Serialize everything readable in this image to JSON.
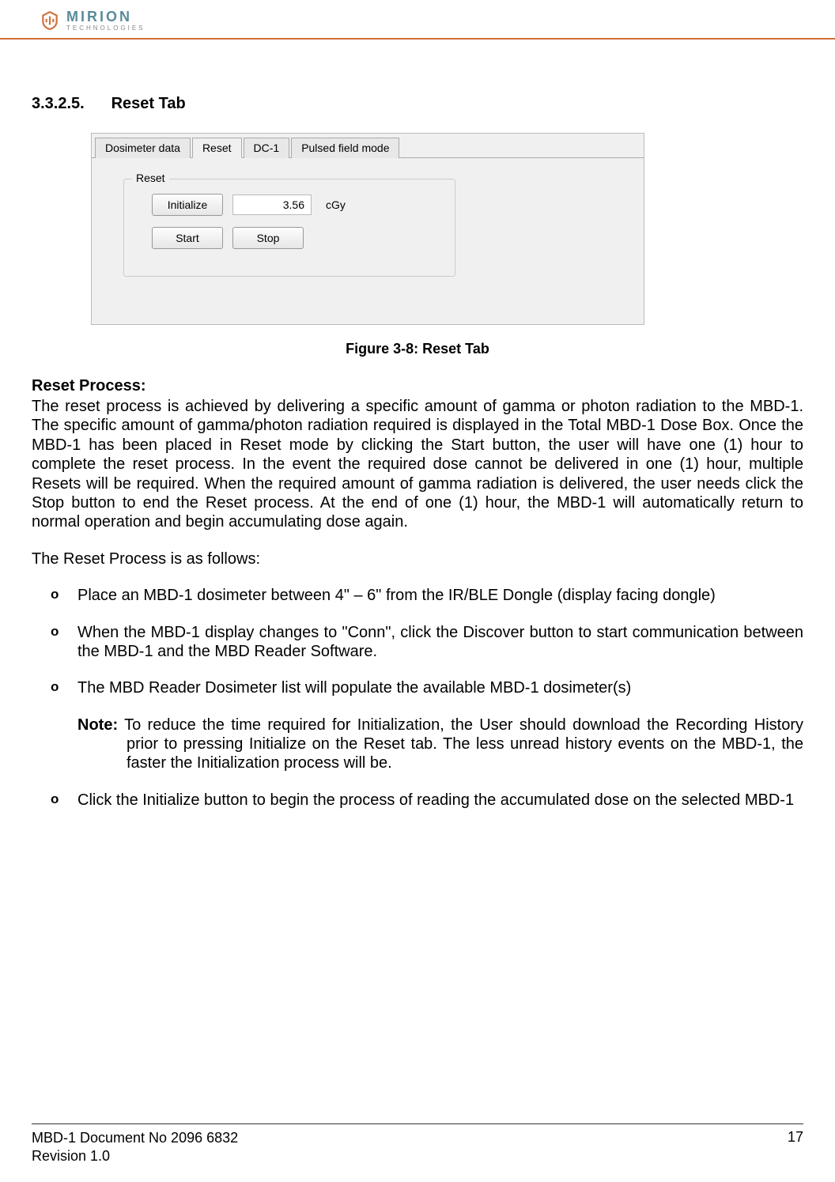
{
  "header": {
    "logo_brand": "MIRION",
    "logo_tagline": "TECHNOLOGIES"
  },
  "section": {
    "number": "3.3.2.5.",
    "title": "Reset Tab"
  },
  "screenshot": {
    "tabs": [
      "Dosimeter data",
      "Reset",
      "DC-1",
      "Pulsed field mode"
    ],
    "active_tab_index": 1,
    "group_label": "Reset",
    "buttons": {
      "initialize": "Initialize",
      "start": "Start",
      "stop": "Stop"
    },
    "dose_value": "3.56",
    "dose_unit": "cGy"
  },
  "figure_caption": "Figure 3-8: Reset Tab",
  "body": {
    "heading": "Reset Process:",
    "main_para": "The reset process is achieved by delivering a specific amount of gamma or photon radiation to the MBD-1.  The specific amount of gamma/photon radiation required is displayed in the Total MBD-1 Dose Box.   Once the MBD-1 has been placed in Reset mode by clicking the Start button, the user will have one (1) hour to complete the reset process.  In the event the required dose cannot be delivered in one (1) hour, multiple Resets will be required. When the required amount of gamma radiation is delivered, the user needs click the Stop button to end the Reset process.  At the end of one (1) hour, the MBD-1 will automatically return to normal operation and begin accumulating dose again.",
    "intro_line": "The Reset Process is as follows:",
    "bullets": [
      "Place an MBD-1 dosimeter between 4\" – 6\" from the IR/BLE Dongle (display facing dongle)",
      "When the MBD-1 display changes to \"Conn\", click the Discover button to start communication between the MBD-1 and the MBD Reader Software.",
      "The MBD Reader Dosimeter list will populate the available MBD-1 dosimeter(s)",
      "Click the Initialize button to begin the process of reading the accumulated dose on the selected MBD-1"
    ],
    "note_label": "Note:",
    "note_text": " To reduce the time required for Initialization, the User should download the Recording History prior to pressing Initialize on the Reset tab. The less unread history events on the MBD-1, the faster the Initialization process will be."
  },
  "footer": {
    "doc_id": "MBD-1 Document No 2096 6832",
    "revision": "Revision 1.0",
    "page": "17"
  }
}
